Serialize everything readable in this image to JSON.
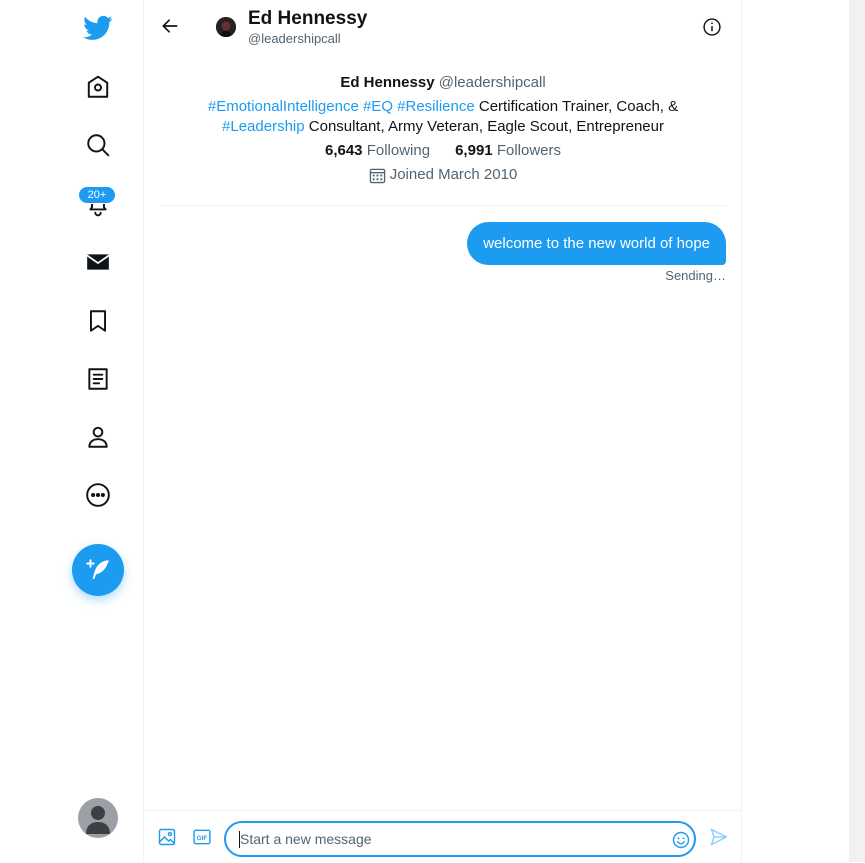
{
  "nav": {
    "notifications_badge": "20+",
    "items": [
      "home",
      "explore",
      "notifications",
      "messages",
      "bookmarks",
      "lists",
      "profile",
      "more"
    ]
  },
  "header": {
    "name": "Ed Hennessy",
    "handle": "@leadershipcall"
  },
  "profile": {
    "name": "Ed Hennessy",
    "handle": "@leadershipcall",
    "bio_tags_line1": [
      "#EmotionalIntelligence",
      "#EQ",
      "#Resilience"
    ],
    "bio_text_line1": "Certification Trainer, Coach, &",
    "bio_tag_line2": "#Leadership",
    "bio_text_line2": "Consultant, Army Veteran, Eagle Scout, Entrepreneur",
    "following_count": "6,643",
    "following_label": "Following",
    "followers_count": "6,991",
    "followers_label": "Followers",
    "joined": "Joined March 2010"
  },
  "conversation": {
    "messages": [
      {
        "text": "welcome to the new world of hope",
        "status": "Sending…"
      }
    ]
  },
  "composer": {
    "placeholder": "Start a new message",
    "value": ""
  },
  "colors": {
    "accent": "#1d9bf0",
    "text": "#0f1419",
    "secondary_text": "#536471"
  }
}
